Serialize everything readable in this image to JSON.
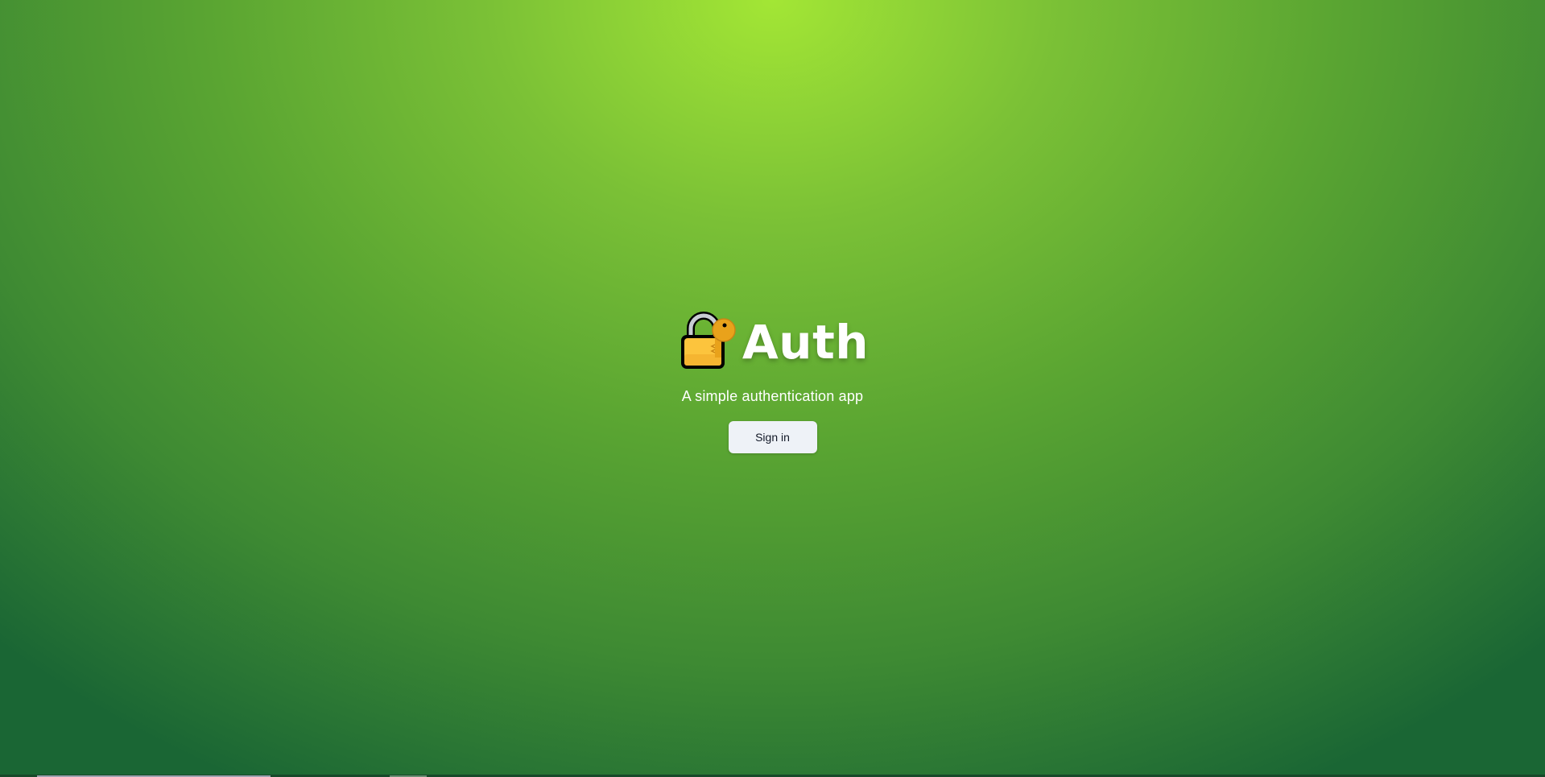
{
  "app": {
    "title": "Auth",
    "subtitle": "A simple authentication app",
    "logo_icon": "lock-with-key-icon"
  },
  "actions": {
    "sign_in_label": "Sign in"
  },
  "colors": {
    "background_top": "#a3e635",
    "background_bottom": "#1a6634",
    "button_bg": "#eef2f7",
    "button_text": "#111827",
    "title_text": "#ffffff"
  }
}
